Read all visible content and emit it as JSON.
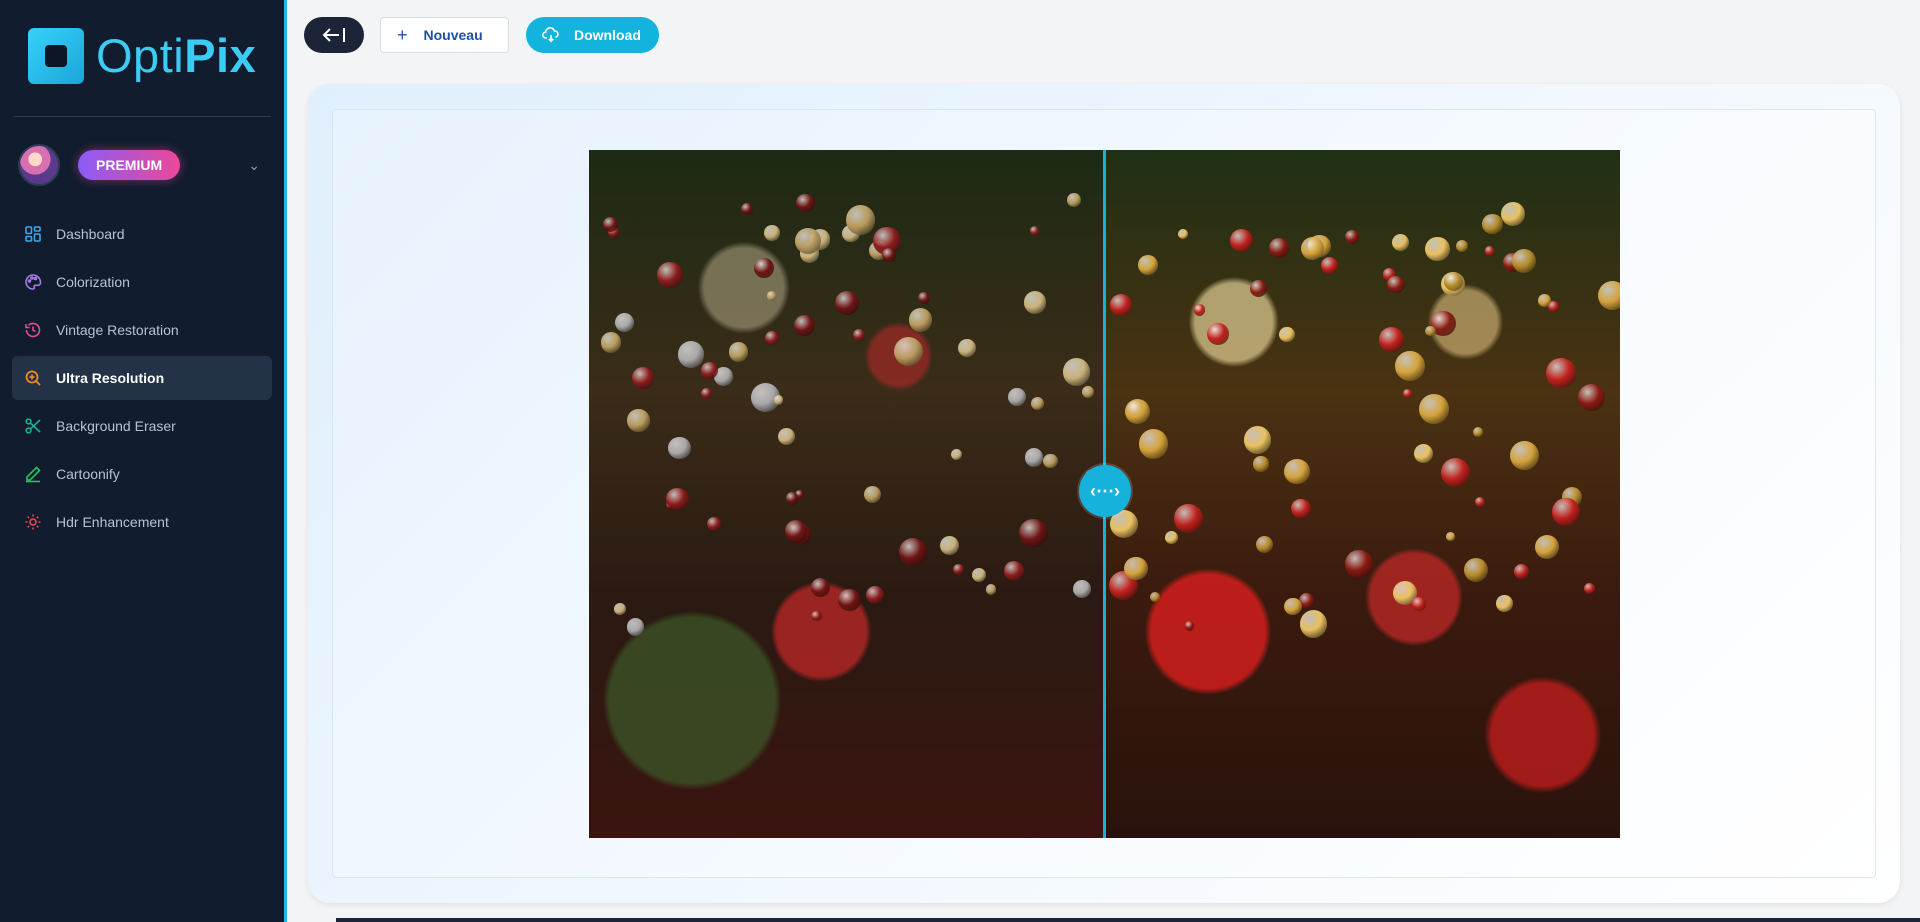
{
  "brand": {
    "name_light": "Opti",
    "name_bold": "Pix"
  },
  "user": {
    "badge": "PREMIUM"
  },
  "sidebar": {
    "items": [
      {
        "label": "Dashboard",
        "icon": "grid-icon",
        "color": "#3ba7e6"
      },
      {
        "label": "Colorization",
        "icon": "palette-icon",
        "color": "#a77be6"
      },
      {
        "label": "Vintage Restoration",
        "icon": "history-icon",
        "color": "#e34d8e"
      },
      {
        "label": "Ultra Resolution",
        "icon": "zoom-in-icon",
        "color": "#f08a24",
        "active": true
      },
      {
        "label": "Background Eraser",
        "icon": "scissors-icon",
        "color": "#1fae8e"
      },
      {
        "label": "Cartoonify",
        "icon": "pen-icon",
        "color": "#22c55e"
      },
      {
        "label": "Hdr Enhancement",
        "icon": "sun-icon",
        "color": "#e84a4a"
      }
    ]
  },
  "toolbar": {
    "new_label": "Nouveau",
    "download_label": "Download"
  },
  "compare": {
    "slider_position": 0.5
  },
  "colors": {
    "accent": "#12b3dd",
    "sidebar_bg": "#111c2e",
    "premium_from": "#8b5cf6",
    "premium_to": "#ec4899"
  }
}
